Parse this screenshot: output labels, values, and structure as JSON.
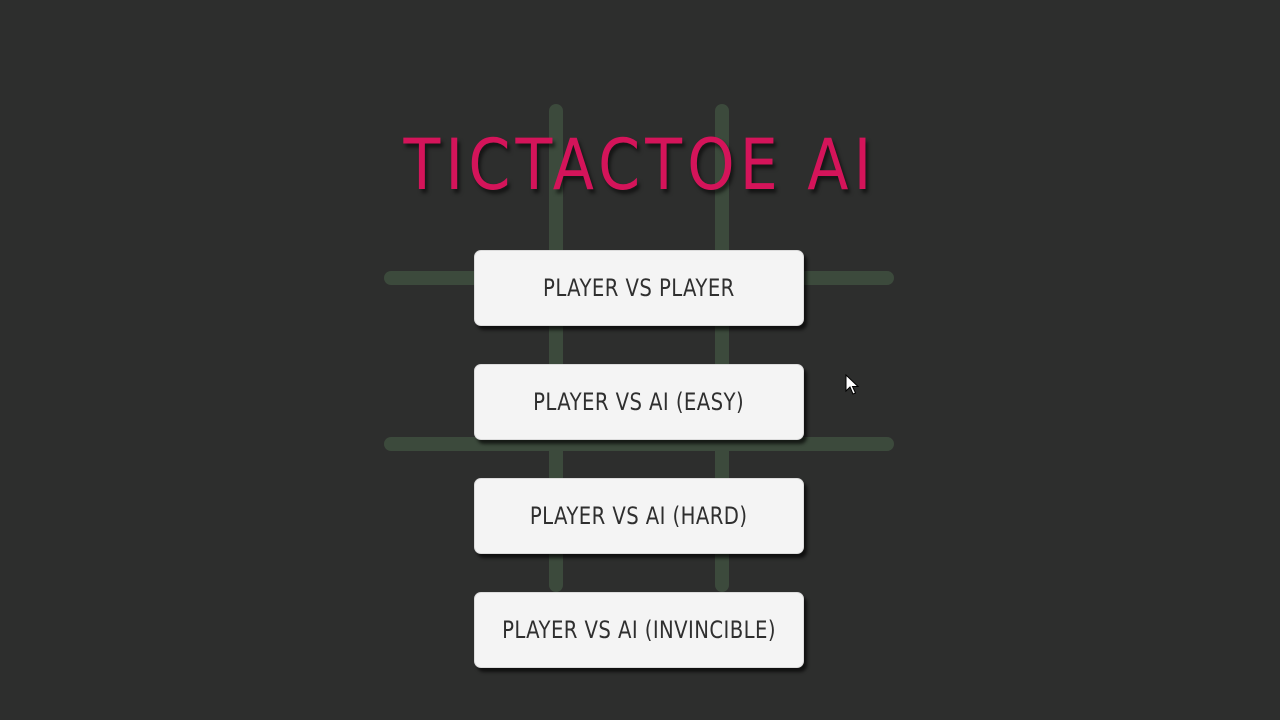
{
  "title": "TICTACTOE AI",
  "menu": {
    "buttons": [
      {
        "label": "PLAYER VS PLAYER"
      },
      {
        "label": "PLAYER VS AI (EASY)"
      },
      {
        "label": "PLAYER VS AI (HARD)"
      },
      {
        "label": "PLAYER VS AI (INVINCIBLE)"
      }
    ]
  },
  "colors": {
    "background": "#2d2e2d",
    "title": "#d4145a",
    "grid": "#3c4a3c",
    "button": "#f4f4f4",
    "button_text": "#2f2f2f"
  },
  "icons": {
    "cursor": "mouse-pointer-icon"
  }
}
